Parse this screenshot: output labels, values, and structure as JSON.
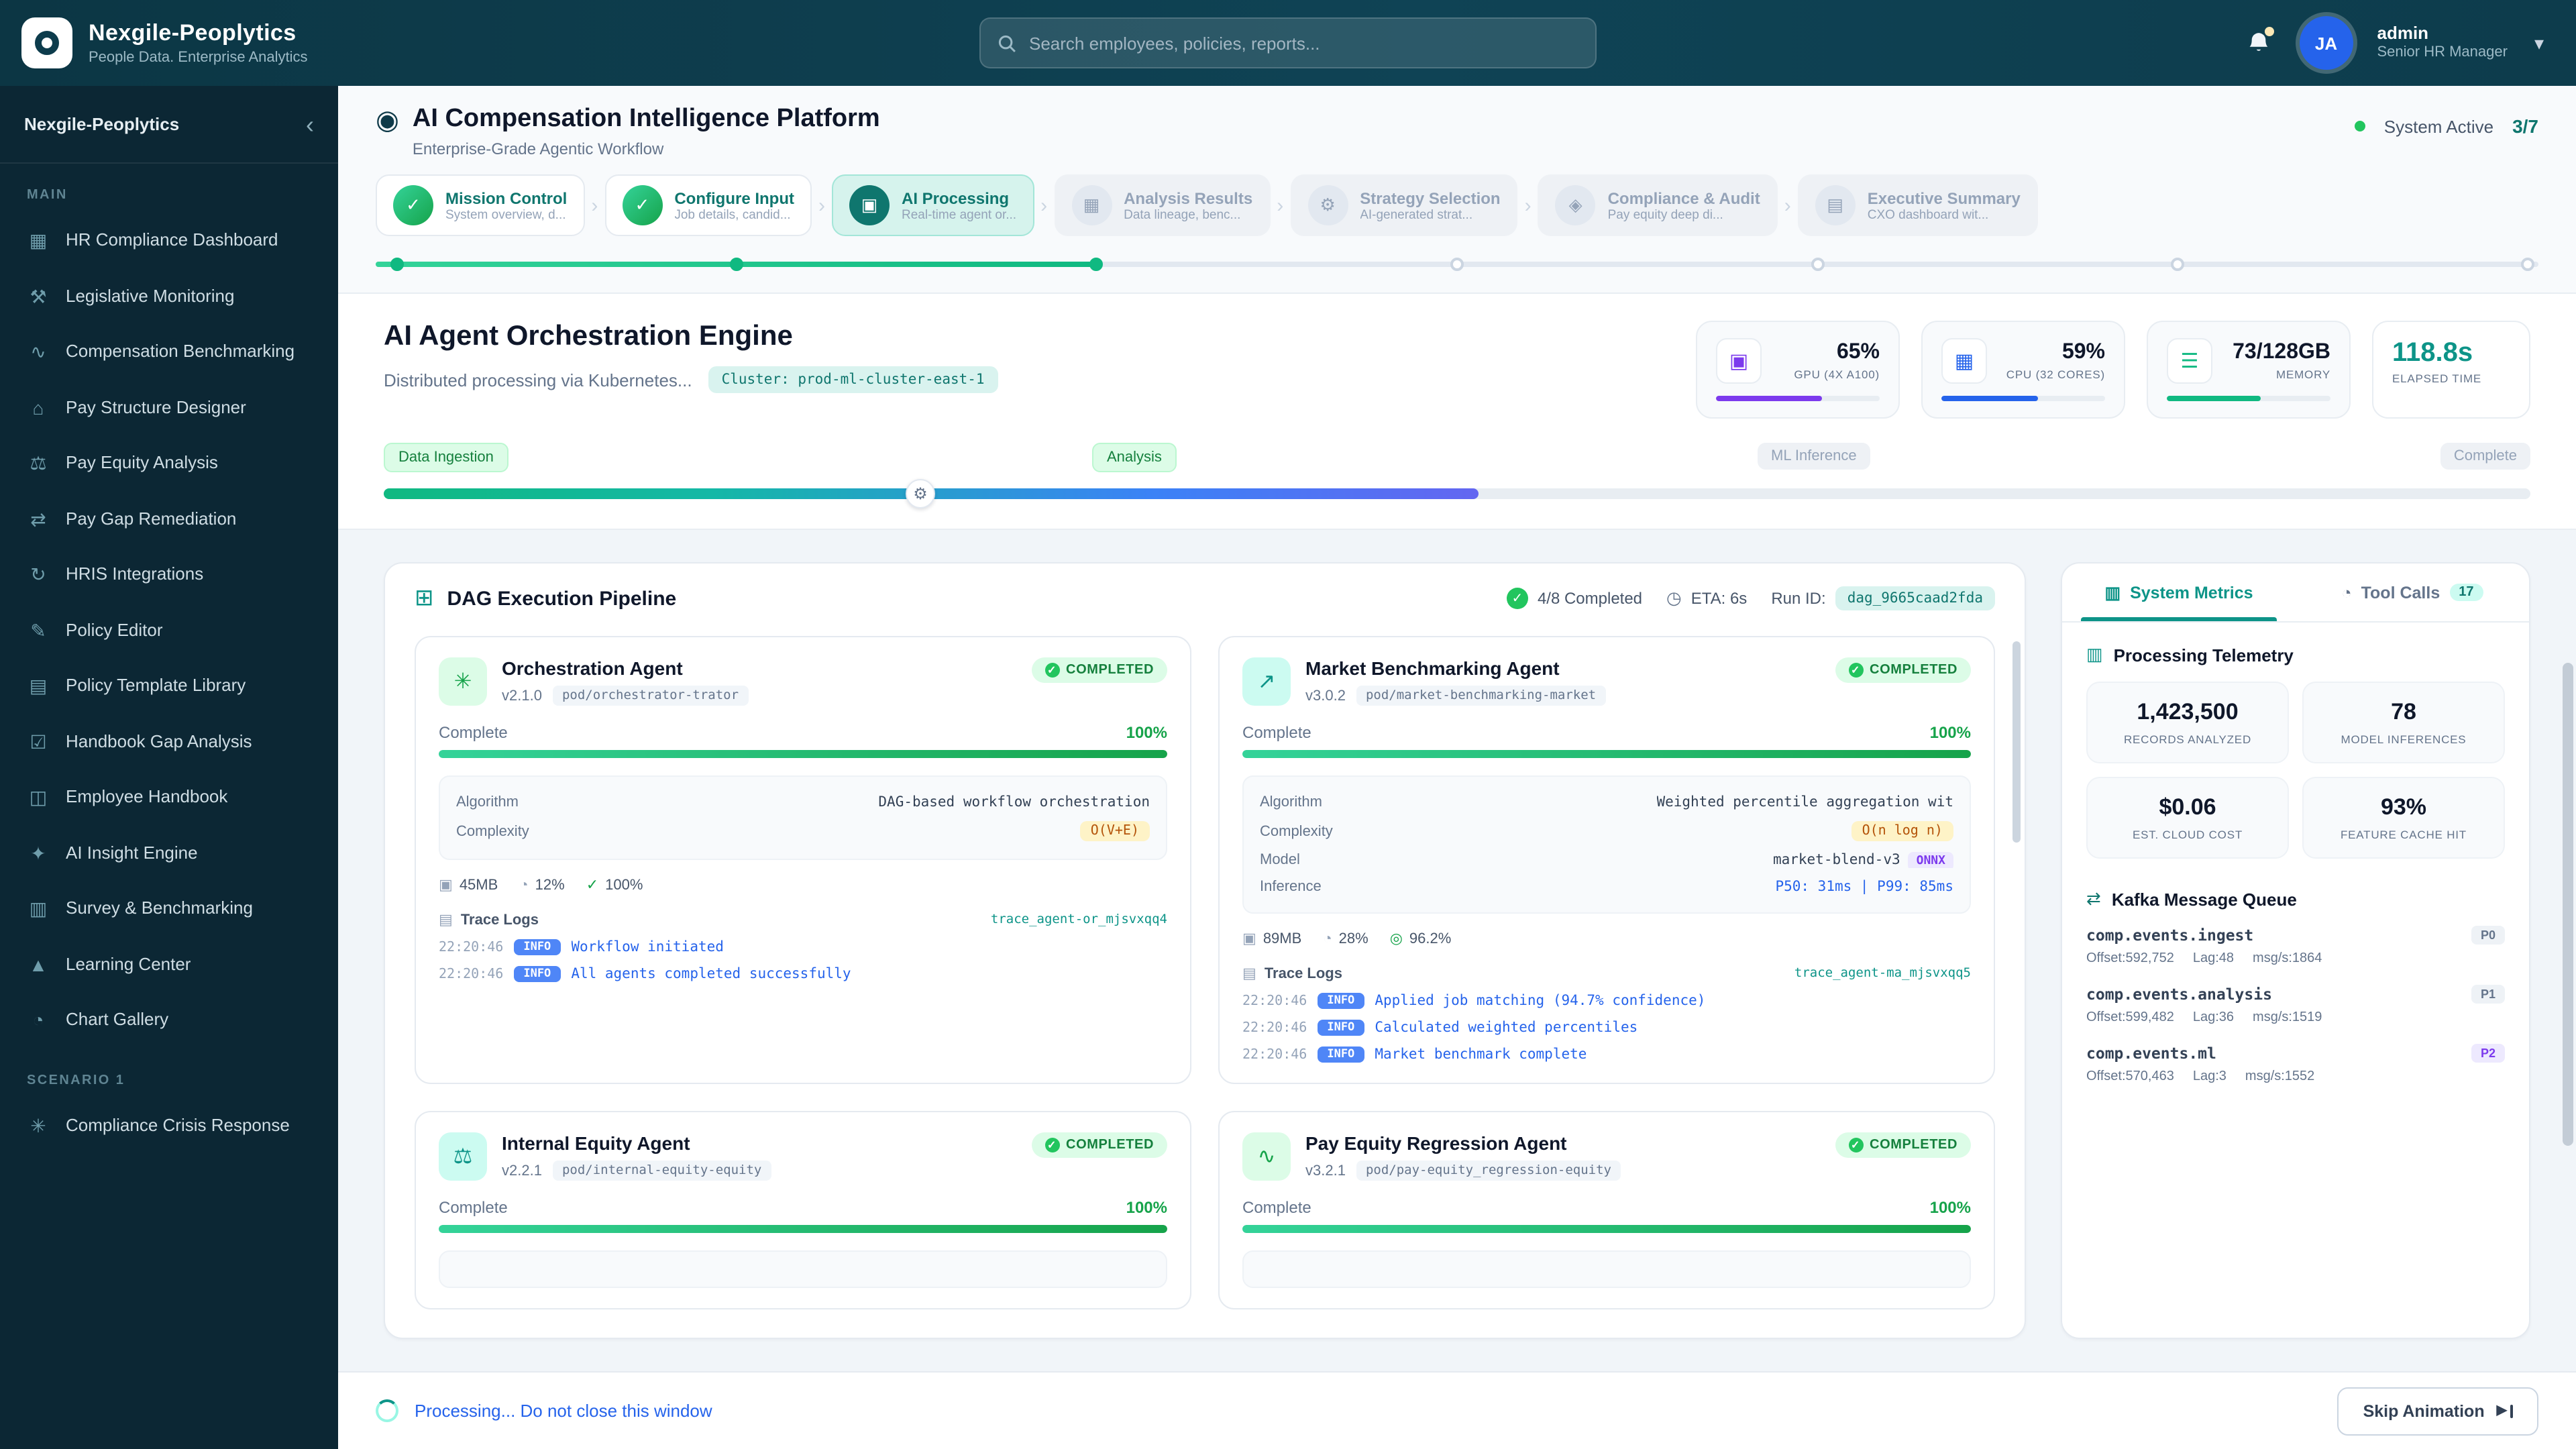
{
  "colors": {
    "brand_dark": "#0c3644",
    "sidebar_dark": "#0c2734",
    "accent_teal": "#0d9488",
    "success_green": "#16a34a",
    "info_blue": "#2563eb",
    "warn_amber": "#b45309",
    "gpu_purple": "#7c3aed"
  },
  "topbar": {
    "brand_name": "Nexgile-Peoplytics",
    "brand_tagline": "People Data. Enterprise Analytics",
    "search_placeholder": "Search employees, policies, reports...",
    "user_initials": "JA",
    "user_name": "admin",
    "user_role": "Senior HR Manager"
  },
  "sidebar": {
    "title": "Nexgile-Peoplytics",
    "collapse_icon": "‹",
    "section_main": "MAIN",
    "section_scenario": "SCENARIO 1",
    "items": [
      {
        "icon": "▦",
        "label": "HR Compliance Dashboard"
      },
      {
        "icon": "⚒",
        "label": "Legislative Monitoring"
      },
      {
        "icon": "∿",
        "label": "Compensation Benchmarking"
      },
      {
        "icon": "⌂",
        "label": "Pay Structure Designer"
      },
      {
        "icon": "⚖",
        "label": "Pay Equity Analysis"
      },
      {
        "icon": "⇄",
        "label": "Pay Gap Remediation"
      },
      {
        "icon": "↻",
        "label": "HRIS Integrations"
      },
      {
        "icon": "✎",
        "label": "Policy Editor"
      },
      {
        "icon": "▤",
        "label": "Policy Template Library"
      },
      {
        "icon": "☑",
        "label": "Handbook Gap Analysis"
      },
      {
        "icon": "◫",
        "label": "Employee Handbook"
      },
      {
        "icon": "✦",
        "label": "AI Insight Engine"
      },
      {
        "icon": "▥",
        "label": "Survey & Benchmarking"
      },
      {
        "icon": "▲",
        "label": "Learning Center"
      },
      {
        "icon": "◔",
        "label": "Chart Gallery"
      }
    ],
    "scenario_items": [
      {
        "icon": "✳",
        "label": "Compliance Crisis Response"
      }
    ]
  },
  "header": {
    "title": "AI Compensation Intelligence Platform",
    "subtitle": "Enterprise-Grade Agentic Workflow",
    "status": "System Active",
    "step_count": "3/7",
    "timeline_pct": 33.3
  },
  "steps": [
    {
      "icon": "✓",
      "title": "Mission Control",
      "subtitle": "System overview, d..."
    },
    {
      "icon": "✓",
      "title": "Configure Input",
      "subtitle": "Job details, candid..."
    },
    {
      "icon": "▣",
      "title": "AI Processing",
      "subtitle": "Real-time agent or..."
    },
    {
      "icon": "▦",
      "title": "Analysis Results",
      "subtitle": "Data lineage, benc..."
    },
    {
      "icon": "⚙",
      "title": "Strategy Selection",
      "subtitle": "AI-generated strat..."
    },
    {
      "icon": "◈",
      "title": "Compliance & Audit",
      "subtitle": "Pay equity deep di..."
    },
    {
      "icon": "▤",
      "title": "Executive Summary",
      "subtitle": "CXO dashboard wit..."
    }
  ],
  "orchestration": {
    "title": "AI Agent Orchestration Engine",
    "subtitle": "Distributed processing via Kubernetes...",
    "cluster_badge": "Cluster: prod-ml-cluster-east-1",
    "metrics": [
      {
        "icon": "▣",
        "value": "65%",
        "label": "GPU (4X A100)",
        "pct": 65
      },
      {
        "icon": "▦",
        "value": "59%",
        "label": "CPU (32 CORES)",
        "pct": 59
      },
      {
        "icon": "☰",
        "value": "73/128GB",
        "label": "MEMORY",
        "pct": 57
      }
    ],
    "elapsed": {
      "value": "118.8s",
      "label": "ELAPSED TIME"
    },
    "phases": [
      {
        "label": "Data Ingestion"
      },
      {
        "label": "Analysis"
      },
      {
        "label": "ML Inference"
      },
      {
        "label": "Complete"
      }
    ],
    "progress_pct": 51
  },
  "dag": {
    "title": "DAG Execution Pipeline",
    "completed": "4/8 Completed",
    "eta": "ETA: 6s",
    "run_label": "Run ID:",
    "run_id": "dag_9665caad2fda"
  },
  "agents": [
    {
      "icon": "✳",
      "name": "Orchestration Agent",
      "version": "v2.1.0",
      "pod": "pod/orchestrator-trator",
      "status": "COMPLETED",
      "progress_label": "Complete",
      "progress_value": "100%",
      "progress_pct": 100,
      "details": [
        {
          "key": "Algorithm",
          "value": "DAG-based workflow orchestration"
        },
        {
          "key": "Complexity",
          "value": "O(V+E)"
        }
      ],
      "stats": [
        {
          "icon": "▣",
          "value": "45MB"
        },
        {
          "icon": "◔",
          "value": "12%"
        },
        {
          "icon": "✓",
          "value": "100%"
        }
      ],
      "trace_label": "Trace Logs",
      "trace_id": "trace_agent-or_mjsvxqq4",
      "logs": [
        {
          "time": "22:20:46",
          "level": "INFO",
          "message": "Workflow initiated"
        },
        {
          "time": "22:20:46",
          "level": "INFO",
          "message": "All agents completed successfully"
        }
      ]
    },
    {
      "icon": "↗",
      "name": "Market Benchmarking Agent",
      "version": "v3.0.2",
      "pod": "pod/market-benchmarking-market",
      "status": "COMPLETED",
      "progress_label": "Complete",
      "progress_value": "100%",
      "progress_pct": 100,
      "details": [
        {
          "key": "Algorithm",
          "value": "Weighted percentile aggregation wit"
        },
        {
          "key": "Complexity",
          "value": "O(n log n)"
        },
        {
          "key": "Model",
          "value": "market-blend-v3",
          "badge": "ONNX"
        },
        {
          "key": "Inference",
          "value": "P50: 31ms | P99: 85ms"
        }
      ],
      "stats": [
        {
          "icon": "▣",
          "value": "89MB"
        },
        {
          "icon": "◔",
          "value": "28%"
        },
        {
          "icon": "◎",
          "value": "96.2%"
        }
      ],
      "trace_label": "Trace Logs",
      "trace_id": "trace_agent-ma_mjsvxqq5",
      "logs": [
        {
          "time": "22:20:46",
          "level": "INFO",
          "message": "Applied job matching (94.7% confidence)"
        },
        {
          "time": "22:20:46",
          "level": "INFO",
          "message": "Calculated weighted percentiles"
        },
        {
          "time": "22:20:46",
          "level": "INFO",
          "message": "Market benchmark complete"
        }
      ]
    },
    {
      "icon": "⚖",
      "name": "Internal Equity Agent",
      "version": "v2.2.1",
      "pod": "pod/internal-equity-equity",
      "status": "COMPLETED",
      "progress_label": "Complete",
      "progress_value": "100%",
      "progress_pct": 100
    },
    {
      "icon": "∿",
      "name": "Pay Equity Regression Agent",
      "version": "v3.2.1",
      "pod": "pod/pay-equity_regression-equity",
      "status": "COMPLETED",
      "progress_label": "Complete",
      "progress_value": "100%",
      "progress_pct": 100
    }
  ],
  "panel": {
    "tabs": [
      {
        "icon": "▥",
        "label": "System Metrics"
      },
      {
        "icon": "◔",
        "label": "Tool Calls",
        "badge": "17"
      }
    ],
    "telemetry_title": "Processing Telemetry",
    "stats": [
      {
        "value": "1,423,500",
        "label": "RECORDS ANALYZED"
      },
      {
        "value": "78",
        "label": "MODEL INFERENCES"
      },
      {
        "value": "$0.06",
        "label": "EST. CLOUD COST"
      },
      {
        "value": "93%",
        "label": "FEATURE CACHE HIT"
      }
    ],
    "kafka_title": "Kafka Message Queue",
    "topics": [
      {
        "name": "comp.events.ingest",
        "priority": "P0",
        "offset": "Offset:592,752",
        "lag": "Lag:48",
        "rate": "msg/s:1864"
      },
      {
        "name": "comp.events.analysis",
        "priority": "P1",
        "offset": "Offset:599,482",
        "lag": "Lag:36",
        "rate": "msg/s:1519"
      },
      {
        "name": "comp.events.ml",
        "priority": "P2",
        "offset": "Offset:570,463",
        "lag": "Lag:3",
        "rate": "msg/s:1552"
      }
    ]
  },
  "footer": {
    "processing": "Processing... Do not close this window",
    "skip": "Skip Animation"
  }
}
